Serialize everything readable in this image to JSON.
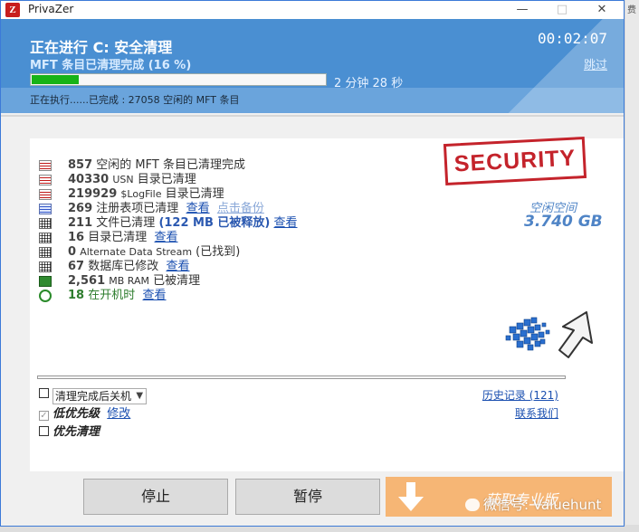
{
  "window": {
    "title": "PrivaZer",
    "minimize": "—",
    "maximize": "□",
    "close": "✕"
  },
  "background_right_text": "费",
  "header": {
    "title": "正在进行 C: 安全清理",
    "subtitle": "MFT 条目已清理完成 (16 %)",
    "timer": "00:02:07",
    "skip": "跳过",
    "progress": 0.16,
    "remaining": "2 分钟 28 秒",
    "executing": "正在执行......已完成 : 27058 空闲的 MFT 条目"
  },
  "colors": {
    "header": "#4a8fd2",
    "progress": "#17b317",
    "stamp": "#c4232b",
    "free_space": "#4f84c6",
    "pro_button": "#f6b675"
  },
  "items": [
    {
      "icon": "red-bars-icon",
      "num": "857",
      "text": "空闲的 MFT 条目已清理完成"
    },
    {
      "icon": "red-bars-icon",
      "num": "40330",
      "label": "USN",
      "text": "目录已清理"
    },
    {
      "icon": "red-bars-icon",
      "num": "219929",
      "label": "$LogFile",
      "text": "目录已清理"
    },
    {
      "icon": "registry-icon",
      "num": "269",
      "text": "注册表项已清理",
      "link1": "查看",
      "link2": "点击备份"
    },
    {
      "icon": "grid-icon",
      "num": "211",
      "text": "文件已清理",
      "extra": "(122 MB 已被释放)",
      "link1": "查看"
    },
    {
      "icon": "grid-icon",
      "num": "16",
      "text": "目录已清理",
      "link1": "查看"
    },
    {
      "icon": "grid-icon",
      "num": "0",
      "label": "Alternate Data Stream",
      "text": "(已找到)"
    },
    {
      "icon": "grid-icon",
      "num": "67",
      "text": "数据库已修改",
      "link1": "查看"
    },
    {
      "icon": "ram-icon",
      "num": "2,561",
      "label": "MB RAM",
      "text": "已被清理"
    },
    {
      "icon": "startup-clock-icon",
      "num": "18",
      "text": "在开机时",
      "link1": "查看"
    }
  ],
  "stamp": "SECURITY",
  "free_space": {
    "label": "空闲空间",
    "value": "3.740 GB"
  },
  "options": {
    "shutdown_label": "清理完成后关机",
    "low_priority": "低优先级",
    "modify": "修改",
    "priority_clean": "优先清理",
    "history": "历史记录 (121)",
    "contact": "联系我们"
  },
  "buttons": {
    "stop": "停止",
    "pause": "暂停",
    "pro": "获取专业版"
  },
  "watermark": "微信号: Valuehunt"
}
